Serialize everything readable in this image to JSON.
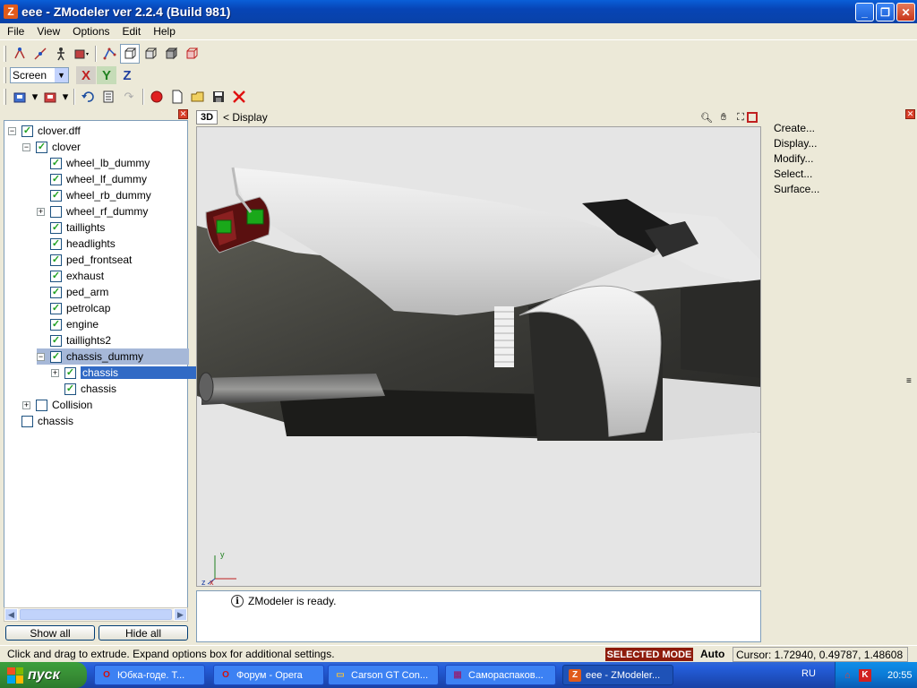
{
  "window": {
    "title": "eee - ZModeler ver 2.2.4 (Build 981)",
    "app_icon_letter": "Z"
  },
  "menu": [
    "File",
    "View",
    "Options",
    "Edit",
    "Help"
  ],
  "toolbar2": {
    "select_value": "Screen",
    "axes": [
      "X",
      "Y",
      "Z"
    ]
  },
  "tree": {
    "rows": [
      {
        "label": "clover.dff",
        "depth": 0,
        "checked": true,
        "expander": "−"
      },
      {
        "label": "clover",
        "depth": 1,
        "checked": true,
        "expander": "−"
      },
      {
        "label": "wheel_lb_dummy",
        "depth": 2,
        "checked": true,
        "expander": ""
      },
      {
        "label": "wheel_lf_dummy",
        "depth": 2,
        "checked": true,
        "expander": ""
      },
      {
        "label": "wheel_rb_dummy",
        "depth": 2,
        "checked": true,
        "expander": ""
      },
      {
        "label": "wheel_rf_dummy",
        "depth": 2,
        "checked": false,
        "expander": "+"
      },
      {
        "label": "taillights",
        "depth": 2,
        "checked": true,
        "expander": ""
      },
      {
        "label": "headlights",
        "depth": 2,
        "checked": true,
        "expander": ""
      },
      {
        "label": "ped_frontseat",
        "depth": 2,
        "checked": true,
        "expander": ""
      },
      {
        "label": "exhaust",
        "depth": 2,
        "checked": true,
        "expander": ""
      },
      {
        "label": "ped_arm",
        "depth": 2,
        "checked": true,
        "expander": ""
      },
      {
        "label": "petrolcap",
        "depth": 2,
        "checked": true,
        "expander": ""
      },
      {
        "label": "engine",
        "depth": 2,
        "checked": true,
        "expander": ""
      },
      {
        "label": "taillights2",
        "depth": 2,
        "checked": true,
        "expander": ""
      },
      {
        "label": "chassis_dummy",
        "depth": 2,
        "checked": true,
        "expander": "−"
      },
      {
        "label": "chassis",
        "depth": 3,
        "checked": true,
        "expander": "+"
      },
      {
        "label": "chassis",
        "depth": 3,
        "checked": true,
        "expander": ""
      },
      {
        "label": "Collision",
        "depth": 1,
        "checked": false,
        "expander": "+"
      },
      {
        "label": "chassis",
        "depth": 0,
        "checked": false,
        "expander": ""
      }
    ],
    "show_all": "Show all",
    "hide_all": "Hide all"
  },
  "viewport": {
    "mode": "3D",
    "display_label": "< Display",
    "axis_y": "y",
    "axis_x": "x",
    "axis_z": "z"
  },
  "log": {
    "message": "ZModeler is ready.",
    "info_symbol": "i"
  },
  "commands": [
    "Create...",
    "Display...",
    "Modify...",
    "Select...",
    "Surface..."
  ],
  "status": {
    "hint": "Click and drag to extrude. Expand options box for additional settings.",
    "mode": "SELECTED MODE",
    "auto": "Auto",
    "cursor": "Cursor: 1.72940, 0.49787, 1.48608"
  },
  "taskbar": {
    "start": "пуск",
    "tasks": [
      {
        "label": "Юбка-годе. Т...",
        "icon": "O",
        "icon_color": "#d01010"
      },
      {
        "label": "Форум - Opera",
        "icon": "O",
        "icon_color": "#d01010"
      },
      {
        "label": "Carson GT Con...",
        "icon": "▭",
        "icon_color": "#f0c040"
      },
      {
        "label": "Самораспаков...",
        "icon": "▦",
        "icon_color": "#8a2a80"
      },
      {
        "label": "eee - ZModeler...",
        "icon": "Z",
        "icon_color": "#e05a1a"
      }
    ],
    "lang": "RU",
    "clock": "20:55"
  }
}
